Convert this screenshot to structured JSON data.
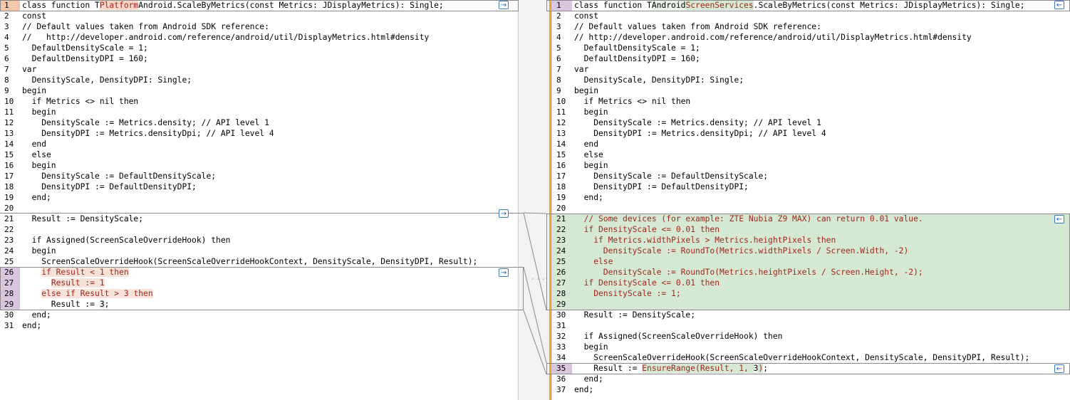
{
  "left": {
    "lines": [
      {
        "n": "1",
        "text": "class function TPlatformAndroid.ScaleByMetrics(const Metrics: JDisplayMetrics): Single;",
        "kind": "current",
        "words": [
          {
            "t": "class function T"
          },
          {
            "t": "Platform",
            "c": "w-old"
          },
          {
            "t": "Android.ScaleByMetrics(const Metrics: JDisplayMetrics): Single;"
          }
        ]
      },
      {
        "n": "2",
        "text": "const"
      },
      {
        "n": "3",
        "text": "// Default values taken from Android SDK reference:"
      },
      {
        "n": "4",
        "text": "//   http://developer.android.com/reference/android/util/DisplayMetrics.html#density"
      },
      {
        "n": "5",
        "text": "  DefaultDensityScale = 1;"
      },
      {
        "n": "6",
        "text": "  DefaultDensityDPI = 160;"
      },
      {
        "n": "7",
        "text": "var"
      },
      {
        "n": "8",
        "text": "  DensityScale, DensityDPI: Single;"
      },
      {
        "n": "9",
        "text": "begin"
      },
      {
        "n": "10",
        "text": "  if Metrics <> nil then"
      },
      {
        "n": "11",
        "text": "  begin"
      },
      {
        "n": "12",
        "text": "    DensityScale := Metrics.density; // API level 1"
      },
      {
        "n": "13",
        "text": "    DensityDPI := Metrics.densityDpi; // API level 4"
      },
      {
        "n": "14",
        "text": "  end"
      },
      {
        "n": "15",
        "text": "  else"
      },
      {
        "n": "16",
        "text": "  begin"
      },
      {
        "n": "17",
        "text": "    DensityScale := DefaultDensityScale;"
      },
      {
        "n": "18",
        "text": "    DensityDPI := DefaultDensityDPI;"
      },
      {
        "n": "19",
        "text": "  end;"
      },
      {
        "n": "20",
        "text": ""
      },
      {
        "n": "21",
        "text": "  Result := DensityScale;"
      },
      {
        "n": "22",
        "text": ""
      },
      {
        "n": "23",
        "text": "  if Assigned(ScreenScaleOverrideHook) then"
      },
      {
        "n": "24",
        "text": "  begin"
      },
      {
        "n": "25",
        "text": "    ScreenScaleOverrideHook(ScreenScaleOverrideHookContext, DensityScale, DensityDPI, Result);"
      },
      {
        "n": "26",
        "text": "    if Result < 1 then",
        "kind": "changed"
      },
      {
        "n": "27",
        "text": "      Result := 1",
        "kind": "changed"
      },
      {
        "n": "28",
        "text": "    else if Result > 3 then",
        "kind": "changed"
      },
      {
        "n": "29",
        "text": "      Result := 3;",
        "kind": "changed-last",
        "words": [
          {
            "t": "      Result := "
          },
          {
            "t": "3",
            "c": "w-plain"
          },
          {
            "t": ";"
          }
        ]
      },
      {
        "n": "30",
        "text": "  end;"
      },
      {
        "n": "31",
        "text": "end;"
      }
    ]
  },
  "right": {
    "lines": [
      {
        "n": "1",
        "text": "class function TAndroidScreenServices.ScaleByMetrics(const Metrics: JDisplayMetrics): Single;",
        "kind": "current",
        "words": [
          {
            "t": "class function T"
          },
          {
            "t": "Android",
            "c": "w-plain"
          },
          {
            "t": "ScreenServices",
            "c": "w-new"
          },
          {
            "t": ".ScaleByMetrics(const Metrics: JDisplayMetrics): Single;"
          }
        ]
      },
      {
        "n": "2",
        "text": "const"
      },
      {
        "n": "3",
        "text": "// Default values taken from Android SDK reference:"
      },
      {
        "n": "4",
        "text": "// http://developer.android.com/reference/android/util/DisplayMetrics.html#density"
      },
      {
        "n": "5",
        "text": "  DefaultDensityScale = 1;"
      },
      {
        "n": "6",
        "text": "  DefaultDensityDPI = 160;"
      },
      {
        "n": "7",
        "text": "var"
      },
      {
        "n": "8",
        "text": "  DensityScale, DensityDPI: Single;"
      },
      {
        "n": "9",
        "text": "begin"
      },
      {
        "n": "10",
        "text": "  if Metrics <> nil then"
      },
      {
        "n": "11",
        "text": "  begin"
      },
      {
        "n": "12",
        "text": "    DensityScale := Metrics.density; // API level 1"
      },
      {
        "n": "13",
        "text": "    DensityDPI := Metrics.densityDpi; // API level 4"
      },
      {
        "n": "14",
        "text": "  end"
      },
      {
        "n": "15",
        "text": "  else"
      },
      {
        "n": "16",
        "text": "  begin"
      },
      {
        "n": "17",
        "text": "    DensityScale := DefaultDensityScale;"
      },
      {
        "n": "18",
        "text": "    DensityDPI := DefaultDensityDPI;"
      },
      {
        "n": "19",
        "text": "  end;"
      },
      {
        "n": "20",
        "text": ""
      },
      {
        "n": "21",
        "text": "  // Some devices (for example: ZTE Nubia Z9 MAX) can return 0.01 value.",
        "kind": "inserted"
      },
      {
        "n": "22",
        "text": "  if DensityScale <= 0.01 then",
        "kind": "inserted"
      },
      {
        "n": "23",
        "text": "    if Metrics.widthPixels > Metrics.heightPixels then",
        "kind": "inserted"
      },
      {
        "n": "24",
        "text": "      DensityScale := RoundTo(Metrics.widthPixels / Screen.Width, -2)",
        "kind": "inserted"
      },
      {
        "n": "25",
        "text": "    else",
        "kind": "inserted"
      },
      {
        "n": "26",
        "text": "      DensityScale := RoundTo(Metrics.heightPixels / Screen.Height, -2);",
        "kind": "inserted"
      },
      {
        "n": "27",
        "text": "  if DensityScale <= 0.01 then",
        "kind": "inserted"
      },
      {
        "n": "28",
        "text": "    DensityScale := 1;",
        "kind": "inserted"
      },
      {
        "n": "29",
        "text": "",
        "kind": "inserted"
      },
      {
        "n": "30",
        "text": "  Result := DensityScale;"
      },
      {
        "n": "31",
        "text": ""
      },
      {
        "n": "32",
        "text": "  if Assigned(ScreenScaleOverrideHook) then"
      },
      {
        "n": "33",
        "text": "  begin"
      },
      {
        "n": "34",
        "text": "    ScreenScaleOverrideHook(ScreenScaleOverrideHookContext, DensityScale, DensityDPI, Result);"
      },
      {
        "n": "35",
        "text": "    Result := EnsureRange(Result, 1, 3);",
        "kind": "changed-right",
        "words": [
          {
            "t": "    Result := "
          },
          {
            "t": "EnsureRange(Result, 1, ",
            "c": "w-new"
          },
          {
            "t": "3",
            "c": "w-plain"
          },
          {
            "t": ")",
            "c": "w-new"
          },
          {
            "t": ";"
          }
        ]
      },
      {
        "n": "36",
        "text": "  end;"
      },
      {
        "n": "37",
        "text": "end;"
      }
    ]
  },
  "icons": {
    "copy_right": "→",
    "copy_left": "←",
    "gutter_dots": "···"
  }
}
